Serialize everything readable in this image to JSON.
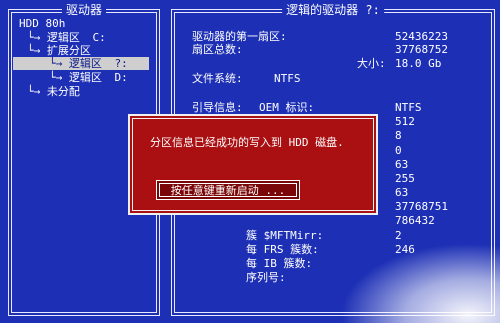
{
  "left_panel": {
    "title": "驱动器",
    "tree": [
      {
        "label": "HDD 80h",
        "drive": ""
      },
      {
        "label": "└→ 逻辑区",
        "drive": "C:"
      },
      {
        "label": "└→ 扩展分区",
        "drive": ""
      },
      {
        "label": "└→ 逻辑区",
        "drive": "?:"
      },
      {
        "label": "└→ 逻辑区",
        "drive": "D:"
      },
      {
        "label": "└→ 未分配",
        "drive": ""
      }
    ]
  },
  "right_panel": {
    "title": "逻辑的驱动器 ?:",
    "first_sector_label": "驱动器的第一扇区:",
    "first_sector_value": "52436223",
    "total_sectors_label": "扇区总数:",
    "total_sectors_value": "37768752",
    "size_label": "大小:",
    "size_value": "18.0 Gb",
    "filesystem_label": "文件系统:",
    "filesystem_value": "NTFS",
    "boot_info_label": "引导信息:",
    "oem_label": "OEM 标识:",
    "oem_value": "NTFS",
    "values": [
      "512",
      "8",
      "0",
      "63",
      "255",
      "63",
      "37768751",
      "786432"
    ],
    "mftmirr_label": "簇 $MFTMirr:",
    "mftmirr_value": "2",
    "frs_label": "每 FRS 簇数:",
    "frs_value": "246",
    "ib_label": "每 IB 簇数:",
    "serial_label": "序列号:"
  },
  "dialog": {
    "message": "分区信息已经成功的写入到 HDD 磁盘.",
    "button_label": "按任意键重新启动 ..."
  },
  "colors": {
    "background": "#1c2fb5",
    "dialog": "#aa0f12",
    "selected": "#cfcfcf"
  }
}
